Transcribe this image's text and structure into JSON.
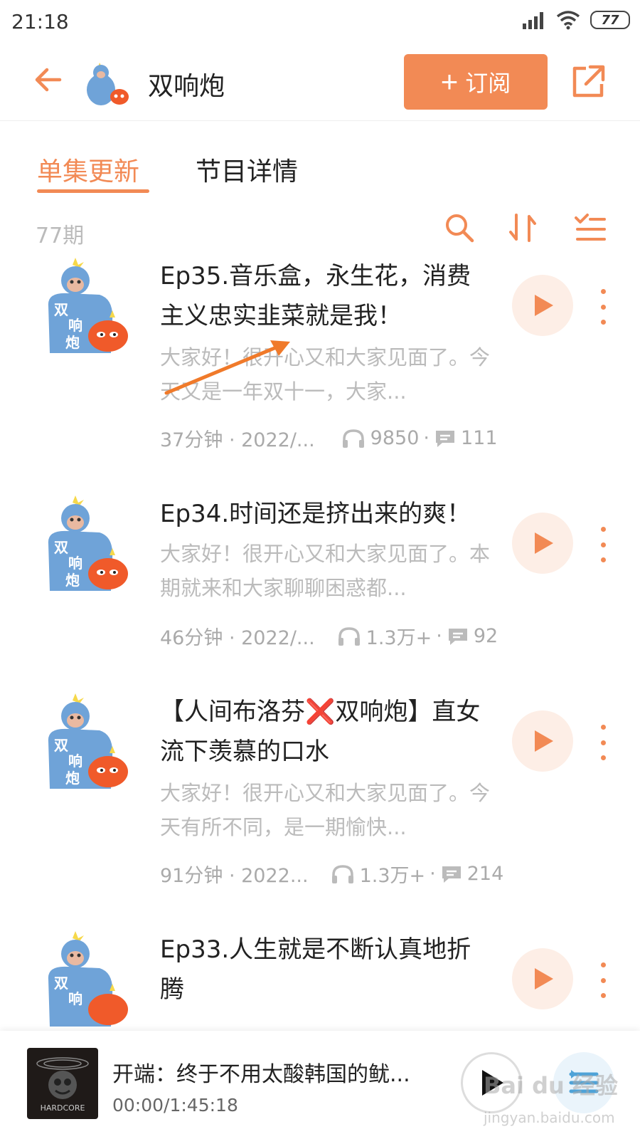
{
  "status_bar": {
    "time": "21:18",
    "battery": "77"
  },
  "header": {
    "title": "双响炮",
    "subscribe_label": "订阅",
    "subscribe_plus": "+"
  },
  "tabs": [
    {
      "label": "单集更新"
    },
    {
      "label": "节目详情"
    }
  ],
  "list_toolbar": {
    "episode_count": "77期"
  },
  "episodes": [
    {
      "title": "Ep35.音乐盒，永生花，消费主义忠实韭菜就是我！",
      "description": "大家好！很开心又和大家见面了。今天又是一年双十一，大家...",
      "duration_date": "37分钟 · 2022/...",
      "plays": "9850",
      "comments": "111"
    },
    {
      "title": "Ep34.时间还是挤出来的爽！",
      "description": "大家好！很开心又和大家见面了。本期就来和大家聊聊困惑都...",
      "duration_date": "46分钟 · 2022/...",
      "plays": "1.3万+",
      "comments": "92"
    },
    {
      "title": "【人间布洛芬❌双响炮】直女流下羡慕的口水",
      "description": "大家好！很开心又和大家见面了。今天有所不同，是一期愉快...",
      "duration_date": "91分钟 · 2022...",
      "plays": "1.3万+",
      "comments": "214"
    },
    {
      "title": "Ep33.人生就是不断认真地折腾",
      "description": "",
      "duration_date": "",
      "plays": "",
      "comments": ""
    }
  ],
  "player": {
    "title": "开端：终于不用太酸韩国的鱿...",
    "time": "00:00/1:45:18",
    "cover_text": "HARDCORE"
  },
  "watermark": {
    "brand": "Bai du 经验",
    "url": "jingyan.baidu.com"
  },
  "colors": {
    "accent": "#f28a55",
    "play_bg": "#fdeee6"
  }
}
